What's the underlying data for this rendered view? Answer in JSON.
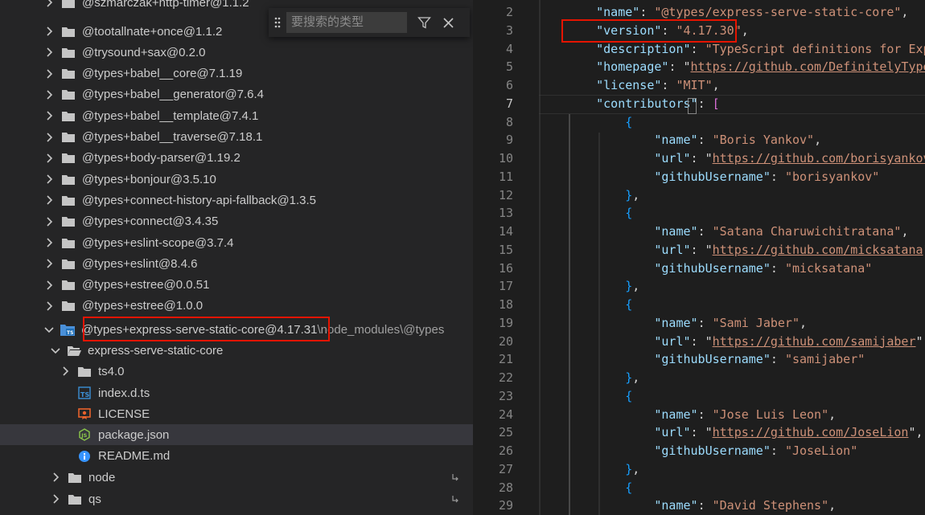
{
  "explorer": {
    "top_partial_label": "@szmarczak+http-timer@1.1.2",
    "items": [
      {
        "label": "@tootallnate+once@1.1.2"
      },
      {
        "label": "@trysound+sax@0.2.0"
      },
      {
        "label": "@types+babel__core@7.1.19"
      },
      {
        "label": "@types+babel__generator@7.6.4"
      },
      {
        "label": "@types+babel__template@7.4.1"
      },
      {
        "label": "@types+babel__traverse@7.18.1"
      },
      {
        "label": "@types+body-parser@1.19.2"
      },
      {
        "label": "@types+bonjour@3.5.10"
      },
      {
        "label": "@types+connect-history-api-fallback@1.3.5"
      },
      {
        "label": "@types+connect@3.4.35"
      },
      {
        "label": "@types+eslint-scope@3.7.4"
      },
      {
        "label": "@types+eslint@8.4.6"
      },
      {
        "label": "@types+estree@0.0.51"
      },
      {
        "label": "@types+estree@1.0.0"
      }
    ],
    "open_package": {
      "label": "@types+express-serve-static-core@4.17.31",
      "path": "\\node_modules\\@types"
    },
    "sub_folder": {
      "label": "express-serve-static-core"
    },
    "children": [
      {
        "label": "ts4.0",
        "icon": "folder-icon",
        "kind": "folder"
      },
      {
        "label": "index.d.ts",
        "icon": "typescript-file-icon",
        "kind": "file"
      },
      {
        "label": "LICENSE",
        "icon": "license-file-icon",
        "kind": "file"
      },
      {
        "label": "package.json",
        "icon": "nodejs-file-icon",
        "kind": "file"
      },
      {
        "label": "README.md",
        "icon": "info-file-icon",
        "kind": "file"
      }
    ],
    "after": [
      {
        "label": "node"
      },
      {
        "label": "qs"
      }
    ]
  },
  "find_widget": {
    "placeholder": "要搜索的类型"
  },
  "editor": {
    "line_numbers": [
      "2",
      "3",
      "4",
      "5",
      "6",
      "7",
      "8",
      "9",
      "10",
      "11",
      "12",
      "13",
      "14",
      "15",
      "16",
      "17",
      "18",
      "19",
      "20",
      "21",
      "22",
      "23",
      "24",
      "25",
      "26",
      "27",
      "28",
      "29"
    ],
    "active_line": "7",
    "top_line": {
      "key": "\"name\"",
      "value": "\"@types/express-serve-static-core\""
    },
    "version": {
      "key": "\"version\"",
      "value": "\"4.17.30\""
    },
    "description": {
      "key": "\"description\"",
      "value": "\"TypeScript definitions for Expre"
    },
    "homepage": {
      "key": "\"homepage\"",
      "value": "https://github.com/DefinitelyTyped/"
    },
    "license": {
      "key": "\"license\"",
      "value": "\"MIT\""
    },
    "contributors_key": "\"contributors\"",
    "name_key": "\"name\"",
    "url_key": "\"url\"",
    "github_key": "\"githubUsername\"",
    "contributors": [
      {
        "name": "\"Boris Yankov\"",
        "url": "https://github.com/borisyankov",
        "github": "\"borisyankov\""
      },
      {
        "name": "\"Satana Charuwichitratana\"",
        "url": "https://github.com/micksatana",
        "github": "\"micksatana\""
      },
      {
        "name": "\"Sami Jaber\"",
        "url": "https://github.com/samijaber",
        "github": "\"samijaber\""
      },
      {
        "name": "\"Jose Luis Leon\"",
        "url": "https://github.com/JoseLion",
        "github": "\"JoseLion\""
      },
      {
        "name": "\"David Stephens\""
      }
    ]
  },
  "colors": {
    "highlight_box": "#e51400",
    "key": "#9cdcfe",
    "string": "#ce9178",
    "bracket_gold": "#ffd700",
    "bracket_violet": "#da70d6",
    "bracket_blue": "#179fff"
  }
}
